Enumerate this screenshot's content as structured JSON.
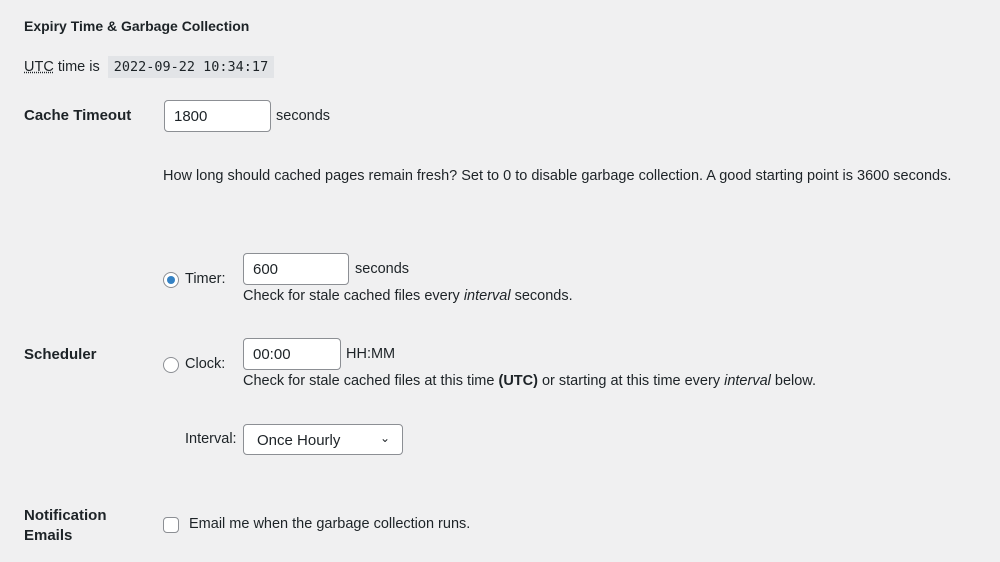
{
  "section_title": "Expiry Time & Garbage Collection",
  "utc": {
    "abbr": "UTC",
    "prefix": " time is",
    "value": "2022-09-22 10:34:17"
  },
  "cache_timeout": {
    "label": "Cache Timeout",
    "value": "1800",
    "unit": "seconds",
    "description": "How long should cached pages remain fresh? Set to 0 to disable garbage collection. A good starting point is 3600 seconds."
  },
  "scheduler": {
    "label": "Scheduler",
    "timer": {
      "label": "Timer:",
      "selected": true,
      "value": "600",
      "unit": "seconds",
      "desc_pre": "Check for stale cached files every ",
      "desc_em": "interval",
      "desc_post": " seconds."
    },
    "clock": {
      "label": "Clock:",
      "selected": false,
      "value": "00:00",
      "unit": "HH:MM",
      "desc_pre": "Check for stale cached files at this time ",
      "desc_bold": "(UTC)",
      "desc_mid": " or starting at this time every ",
      "desc_em": "interval",
      "desc_post": " below."
    },
    "interval": {
      "label": "Interval:",
      "selected": "Once Hourly"
    }
  },
  "notification": {
    "label_line1": "Notification",
    "label_line2": "Emails",
    "checkbox_label": "Email me when the garbage collection runs.",
    "checked": false
  }
}
